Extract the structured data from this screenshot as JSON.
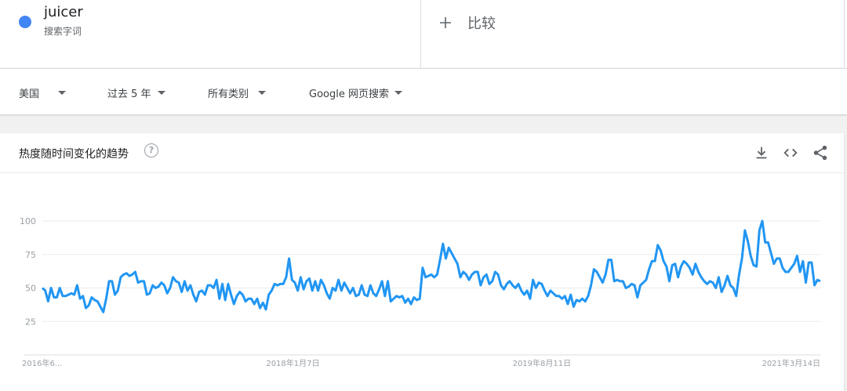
{
  "term": {
    "name": "juicer",
    "type": "搜索字词",
    "color": "#4285f4"
  },
  "compare": {
    "label": "比较"
  },
  "filters": [
    {
      "label": "美国"
    },
    {
      "label": "过去 5 年"
    },
    {
      "label": "所有类别"
    },
    {
      "label": "Google 网页搜索"
    }
  ],
  "card": {
    "title": "热度随时间变化的趋势"
  },
  "tools": [
    {
      "icon": "download-icon"
    },
    {
      "icon": "embed-icon"
    },
    {
      "icon": "share-icon"
    }
  ],
  "chart_data": {
    "type": "line",
    "series": [
      {
        "name": "juicer",
        "color": "#2196f3"
      }
    ],
    "y_ticks": [
      25,
      50,
      75,
      100
    ],
    "ylim": [
      0,
      100
    ],
    "x_tick_labels": [
      "2016年6...",
      "2018年1月7日",
      "2019年8月11日",
      "2021年3月14日"
    ],
    "values": [
      50,
      48,
      40,
      50,
      43,
      43,
      50,
      44,
      44,
      45,
      46,
      45,
      52,
      42,
      44,
      35,
      37,
      43,
      41,
      40,
      36,
      32,
      42,
      55,
      55,
      45,
      48,
      58,
      60,
      61,
      59,
      60,
      62,
      54,
      55,
      55,
      45,
      46,
      52,
      50,
      51,
      54,
      52,
      46,
      50,
      58,
      55,
      54,
      47,
      55,
      48,
      52,
      45,
      40,
      47,
      48,
      45,
      52,
      52,
      50,
      56,
      42,
      53,
      41,
      53,
      45,
      38,
      44,
      47,
      45,
      40,
      42,
      42,
      38,
      42,
      35,
      39,
      34,
      45,
      48,
      53,
      52,
      53,
      53,
      58,
      72,
      56,
      54,
      48,
      58,
      49,
      55,
      57,
      48,
      55,
      48,
      56,
      52,
      46,
      42,
      50,
      48,
      56,
      48,
      54,
      50,
      46,
      50,
      44,
      45,
      52,
      45,
      44,
      52,
      46,
      44,
      49,
      55,
      44,
      55,
      40,
      42,
      44,
      43,
      44,
      39,
      42,
      38,
      43,
      41,
      42,
      65,
      58,
      59,
      60,
      58,
      60,
      71,
      83,
      72,
      80,
      76,
      72,
      68,
      58,
      62,
      60,
      56,
      60,
      62,
      62,
      52,
      58,
      60,
      53,
      55,
      62,
      60,
      52,
      49,
      53,
      55,
      52,
      50,
      53,
      48,
      45,
      48,
      42,
      56,
      50,
      54,
      53,
      48,
      44,
      48,
      46,
      44,
      44,
      42,
      44,
      38,
      45,
      36,
      41,
      40,
      42,
      40,
      44,
      52,
      64,
      62,
      58,
      54,
      60,
      71,
      71,
      55,
      56,
      55,
      55,
      50,
      51,
      53,
      52,
      43,
      52,
      54,
      56,
      64,
      70,
      70,
      82,
      78,
      70,
      66,
      55,
      67,
      68,
      58,
      66,
      70,
      68,
      65,
      60,
      68,
      62,
      58,
      55,
      53,
      55,
      54,
      50,
      58,
      47,
      52,
      59,
      52,
      50,
      44,
      60,
      72,
      93,
      85,
      74,
      67,
      66,
      93,
      100,
      84,
      84,
      76,
      68,
      72,
      72,
      65,
      62,
      62,
      65,
      68,
      74,
      62,
      70,
      54,
      69,
      69,
      52,
      56,
      55
    ]
  }
}
